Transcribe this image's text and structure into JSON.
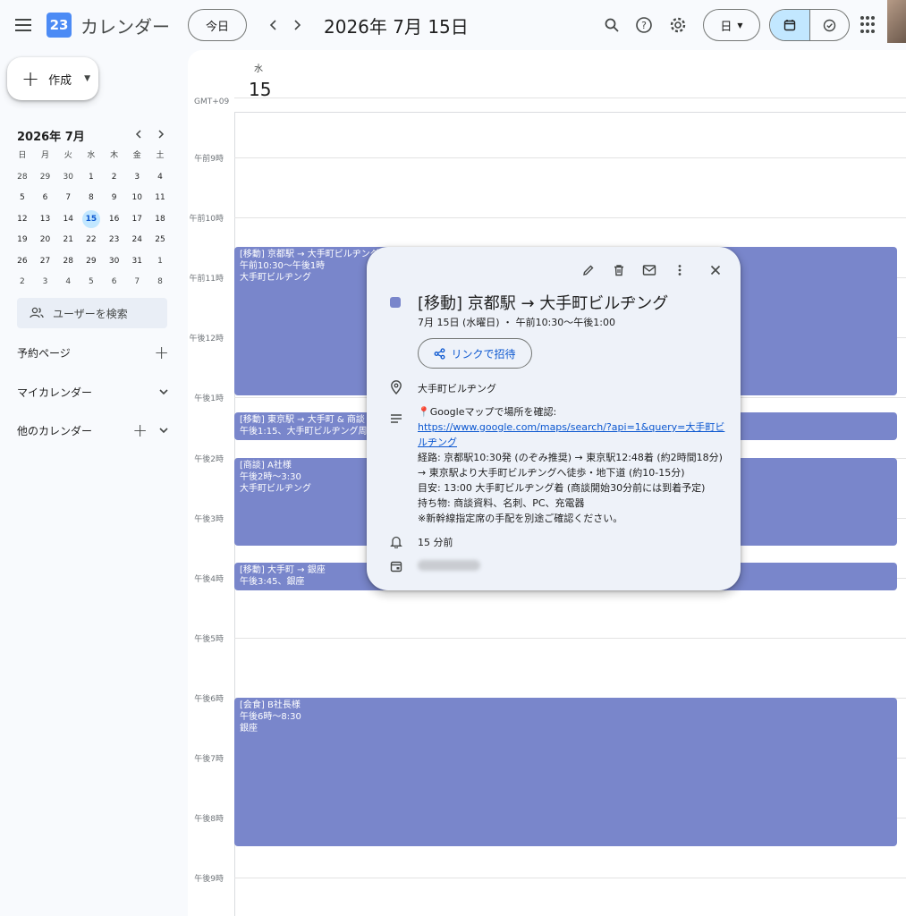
{
  "header": {
    "app_title": "カレンダー",
    "logo_day": "23",
    "today_label": "今日",
    "prev_label": "‹",
    "next_label": "›",
    "current_date": "2026年 7月 15日",
    "view_label": "日",
    "icons": [
      "menu-icon",
      "search-icon",
      "help-icon",
      "settings-icon",
      "apps-icon"
    ]
  },
  "sidebar": {
    "create_label": "作成",
    "mini_calendar": {
      "title": "2026年 7月",
      "weekday_headers": [
        "日",
        "月",
        "火",
        "水",
        "木",
        "金",
        "土"
      ],
      "weeks": [
        [
          "28",
          "29",
          "30",
          "1",
          "2",
          "3",
          "4"
        ],
        [
          "5",
          "6",
          "7",
          "8",
          "9",
          "10",
          "11"
        ],
        [
          "12",
          "13",
          "14",
          "15",
          "16",
          "17",
          "18"
        ],
        [
          "19",
          "20",
          "21",
          "22",
          "23",
          "24",
          "25"
        ],
        [
          "26",
          "27",
          "28",
          "29",
          "30",
          "31",
          "1"
        ],
        [
          "2",
          "3",
          "4",
          "5",
          "6",
          "7",
          "8"
        ]
      ],
      "selected_day": "15"
    },
    "search_people_placeholder": "ユーザーを検索",
    "sections": {
      "booking": "予約ページ",
      "my_calendars": "マイカレンダー",
      "other_calendars": "他のカレンダー"
    }
  },
  "day_view": {
    "weekday": "水",
    "day_number": "15",
    "timezone": "GMT+09",
    "hours": [
      "午前9時",
      "午前10時",
      "午前11時",
      "午後12時",
      "午後1時",
      "午後2時",
      "午後3時",
      "午後4時",
      "午後5時",
      "午後6時",
      "午後7時",
      "午後8時",
      "午後9時"
    ],
    "events": [
      {
        "title": "[移動] 京都駅 → 大手町ビルヂング",
        "time": "午前10:30～午後1時",
        "location": "大手町ビルヂング"
      },
      {
        "title": "[移動] 東京駅 → 大手町 & 商談",
        "time": "午後1:15、大手町ビルヂング周辺",
        "location": ""
      },
      {
        "title": "[商談] A社様",
        "time": "午後2時～3:30",
        "location": "大手町ビルヂング"
      },
      {
        "title": "[移動] 大手町 → 銀座",
        "time": "午後3:45、銀座",
        "location": ""
      },
      {
        "title": "[会食] B社長様",
        "time": "午後6時～8:30",
        "location": "銀座"
      }
    ]
  },
  "popup": {
    "title": "[移動] 京都駅 → 大手町ビルヂング",
    "datetime": "7月 15日 (水曜日) ・ 午前10:30～午後1:00",
    "invite_label": "リンクで招待",
    "location": "大手町ビルヂング",
    "desc_intro": "📍Googleマップで場所を確認:",
    "desc_link": "https://www.google.com/maps/search/?api=1&query=大手町ビルヂング",
    "desc_lines": [
      "経路: 京都駅10:30発 (のぞみ推奨) → 東京駅12:48着 (約2時間18分)",
      "→ 東京駅より大手町ビルヂングへ徒歩・地下道 (約10-15分)",
      "目安: 13:00 大手町ビルヂング着 (商談開始30分前には到着予定)",
      "持ち物: 商談資料、名刺、PC、充電器",
      "※新幹線指定席の手配を別途ご確認ください。"
    ],
    "reminder": "15 分前",
    "event_color": "#7986cb"
  },
  "colors": {
    "accent": "#0b57d0",
    "event": "#7986cb",
    "selected_bg": "#c2e7ff"
  }
}
